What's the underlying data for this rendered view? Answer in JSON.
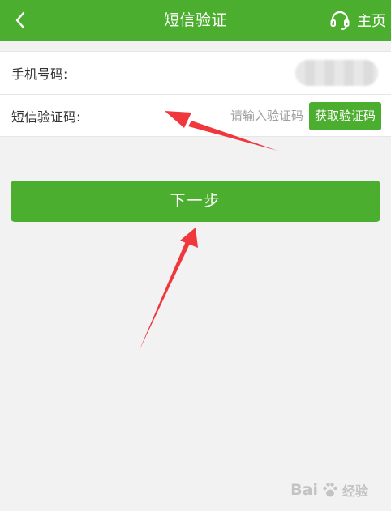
{
  "header": {
    "title": "短信验证",
    "home_label": "主页"
  },
  "form": {
    "phone_label": "手机号码:",
    "code_label": "短信验证码:",
    "code_placeholder": "请输入验证码",
    "get_code_label": "获取验证码"
  },
  "actions": {
    "next_label": "下一步"
  },
  "watermark": {
    "brand": "Bai",
    "suffix": "经验"
  },
  "colors": {
    "accent": "#4cae2e",
    "annotation_arrow": "#f0383c"
  },
  "icons": {
    "back": "chevron-left-icon",
    "support": "headset-icon",
    "paw": "paw-icon"
  }
}
